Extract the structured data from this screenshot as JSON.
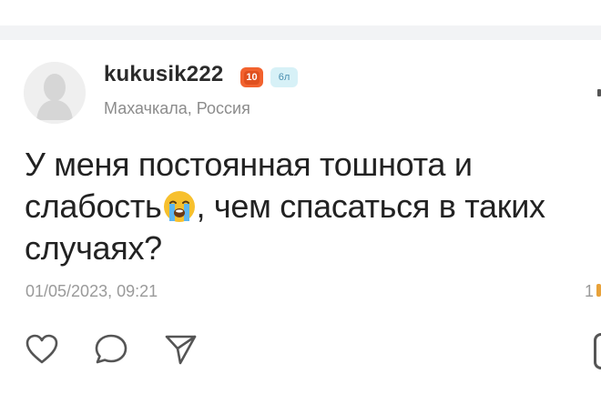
{
  "post": {
    "author": {
      "username": "kukusik222",
      "level": "10",
      "points": "6л",
      "location": "Махачкала, Россия"
    },
    "question_part1": "У меня постоянная тошнота и слабость",
    "emoji": "loudly-crying-face",
    "question_part2": ", чем спасаться в таких случаях?",
    "timestamp": "01/05/2023, 09:21",
    "right_count": "1"
  },
  "actions": [
    "heart-icon",
    "comment-icon",
    "share-icon"
  ],
  "colors": {
    "level_badge": "#f2622e",
    "points_badge_bg": "#d7f1f7",
    "points_badge_text": "#4a8fb0",
    "muted_text": "#9a9a9a",
    "separator": "#f2f3f5"
  }
}
